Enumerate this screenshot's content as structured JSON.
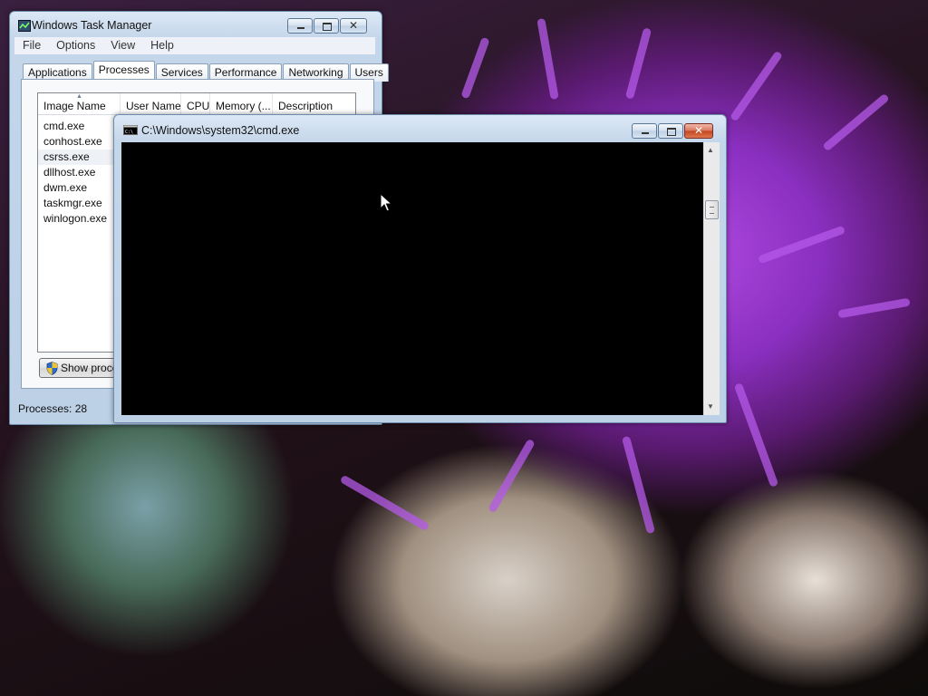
{
  "desktop": {
    "wallpaper": "purple-artichoke-flower"
  },
  "taskmgr": {
    "title": "Windows Task Manager",
    "menu": [
      "File",
      "Options",
      "View",
      "Help"
    ],
    "tabs": [
      "Applications",
      "Processes",
      "Services",
      "Performance",
      "Networking",
      "Users"
    ],
    "active_tab": "Processes",
    "columns": [
      "Image Name",
      "User Name",
      "CPU",
      "Memory (...",
      "Description"
    ],
    "processes": [
      "cmd.exe",
      "conhost.exe",
      "csrss.exe",
      "dllhost.exe",
      "dwm.exe",
      "taskmgr.exe",
      "winlogon.exe"
    ],
    "selected_process": "csrss.exe",
    "show_processes_button": "Show processes from all users",
    "status": "Processes: 28"
  },
  "cmd": {
    "title": "C:\\Windows\\system32\\cmd.exe",
    "console_background": "#000000"
  },
  "colors": {
    "close_button": "#c1441f",
    "window_frame": "#c4d6ea"
  }
}
